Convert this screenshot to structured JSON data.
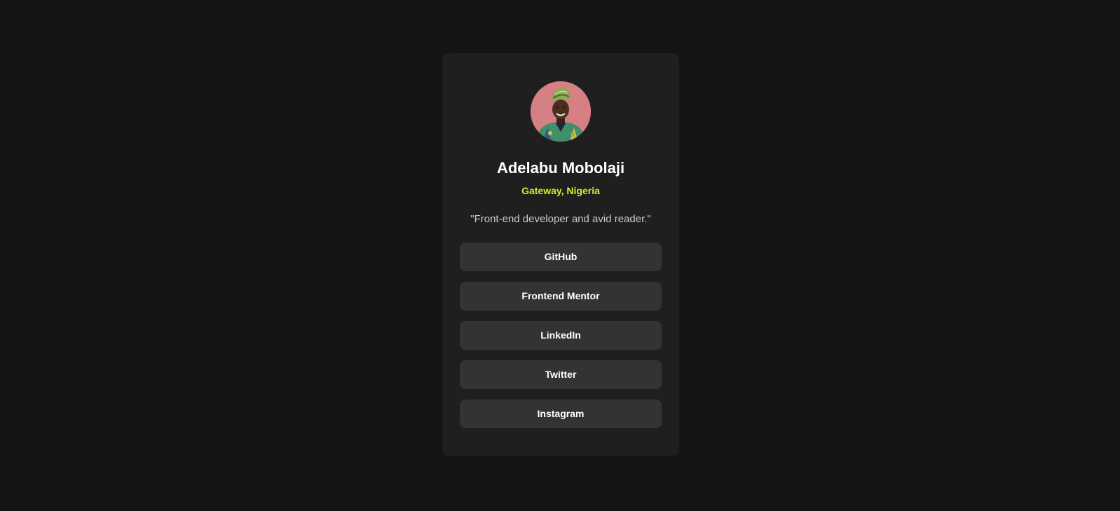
{
  "profile": {
    "name": "Adelabu Mobolaji",
    "location": "Gateway, Nigeria",
    "bio": "\"Front-end developer and avid reader.\"",
    "avatar_icon": "profile-photo"
  },
  "links": [
    {
      "label": "GitHub"
    },
    {
      "label": "Frontend Mentor"
    },
    {
      "label": "LinkedIn"
    },
    {
      "label": "Twitter"
    },
    {
      "label": "Instagram"
    }
  ],
  "colors": {
    "page_background": "#141414",
    "card_background": "#1f1f1f",
    "button_background": "#333333",
    "accent": "#c4f82a",
    "text_primary": "#ffffff",
    "text_secondary": "#cccccc"
  }
}
